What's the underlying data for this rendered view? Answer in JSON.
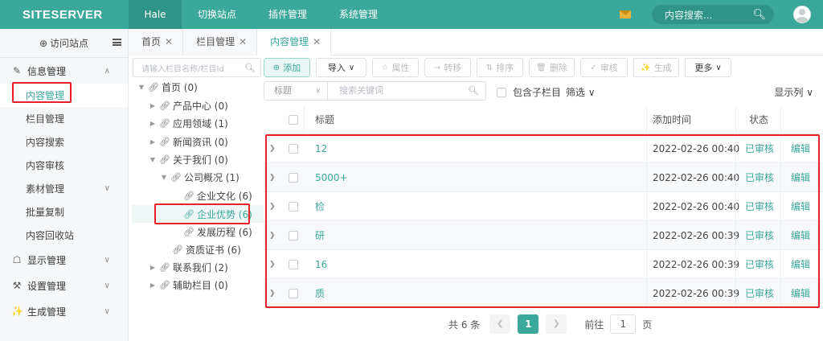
{
  "header": {
    "logo": "SITESERVER",
    "nav": [
      "Hale",
      "切换站点",
      "插件管理",
      "系统管理"
    ],
    "search_placeholder": "内容搜索..."
  },
  "sidebar": {
    "visit": "访问站点",
    "groups": [
      {
        "label": "信息管理",
        "icon": "info-icon",
        "expanded": true,
        "items": [
          "内容管理",
          "栏目管理",
          "内容搜索",
          "内容审核",
          "素材管理",
          "批量复制",
          "内容回收站"
        ]
      },
      {
        "label": "显示管理",
        "icon": "shirt-icon"
      },
      {
        "label": "设置管理",
        "icon": "wrench-icon"
      },
      {
        "label": "生成管理",
        "icon": "magic-icon"
      }
    ]
  },
  "tabs": [
    "首页",
    "栏目管理",
    "内容管理"
  ],
  "tree": {
    "search_placeholder": "请输入栏目名称/栏目Id",
    "nodes": [
      "首页 (0)",
      "产品中心 (0)",
      "应用领域 (1)",
      "新闻资讯 (0)",
      "关于我们 (0)",
      "公司概况 (1)",
      "企业文化 (6)",
      "企业优势 (6)",
      "发展历程 (6)",
      "资质证书 (6)",
      "联系我们 (2)",
      "辅助栏目 (0)"
    ]
  },
  "toolbar": {
    "buttons": [
      "添加",
      "导入",
      "属性",
      "转移",
      "排序",
      "删除",
      "审核",
      "生成",
      "更多"
    ]
  },
  "filter": {
    "field": "标题",
    "keyword_placeholder": "搜索关键词",
    "include_sub": "包含子栏目",
    "filter_label": "筛选",
    "display_columns": "显示列"
  },
  "table": {
    "headers": {
      "title": "标题",
      "time": "添加时间",
      "status": "状态"
    },
    "rows": [
      {
        "title": "12",
        "time": "2022-02-26 00:40",
        "status": "已审核",
        "action": "编辑"
      },
      {
        "title": "5000+",
        "time": "2022-02-26 00:40",
        "status": "已审核",
        "action": "编辑"
      },
      {
        "title": "检",
        "time": "2022-02-26 00:40",
        "status": "已审核",
        "action": "编辑"
      },
      {
        "title": "研",
        "time": "2022-02-26 00:39",
        "status": "已审核",
        "action": "编辑"
      },
      {
        "title": "16",
        "time": "2022-02-26 00:39",
        "status": "已审核",
        "action": "编辑"
      },
      {
        "title": "质",
        "time": "2022-02-26 00:39",
        "status": "已审核",
        "action": "编辑"
      }
    ]
  },
  "pagination": {
    "total": "共 6 条",
    "current": "1",
    "goto_label": "前往",
    "goto_value": "1",
    "page_suffix": "页"
  },
  "colors": {
    "accent": "#3aa89a",
    "highlight": "#e8202a"
  }
}
